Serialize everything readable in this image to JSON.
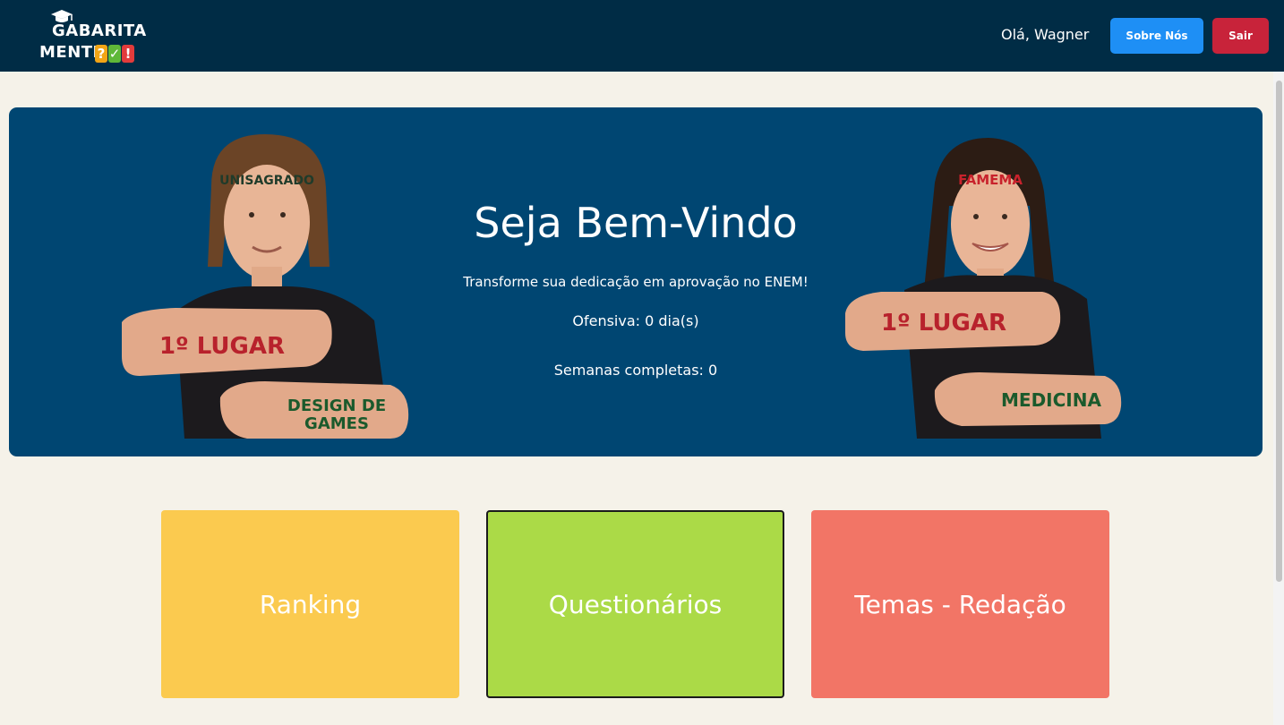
{
  "header": {
    "logo_line1": "GABARITA",
    "logo_line2": "MENTE",
    "logo_marks": [
      "?",
      "✓",
      "!"
    ],
    "greeting": "Olá, Wagner",
    "about_button": "Sobre Nós",
    "logout_button": "Sair"
  },
  "hero": {
    "title": "Seja Bem-Vindo",
    "subtitle": "Transforme sua dedicação em aprovação no ENEM!",
    "streak": "Ofensiva: 0 dia(s)",
    "weeks": "Semanas completas: 0",
    "left_person": {
      "forehead": "UNISAGRADO",
      "arm_top": "1º LUGAR",
      "arm_bottom_line1": "DESIGN DE",
      "arm_bottom_line2": "GAMES"
    },
    "right_person": {
      "forehead": "FAMEMA",
      "arm_top": "1º LUGAR",
      "arm_bottom": "MEDICINA"
    }
  },
  "cards": {
    "ranking": "Ranking",
    "quizzes": "Questionários",
    "essay_topics": "Temas - Redação"
  },
  "colors": {
    "topbar": "#002c45",
    "hero": "#004672",
    "about_button": "#1e8ff5",
    "logout_button": "#c8233a",
    "card_ranking": "#fbca4f",
    "card_quizzes": "#abda47",
    "card_essay": "#f27566",
    "page_background": "#f5f2e9"
  }
}
